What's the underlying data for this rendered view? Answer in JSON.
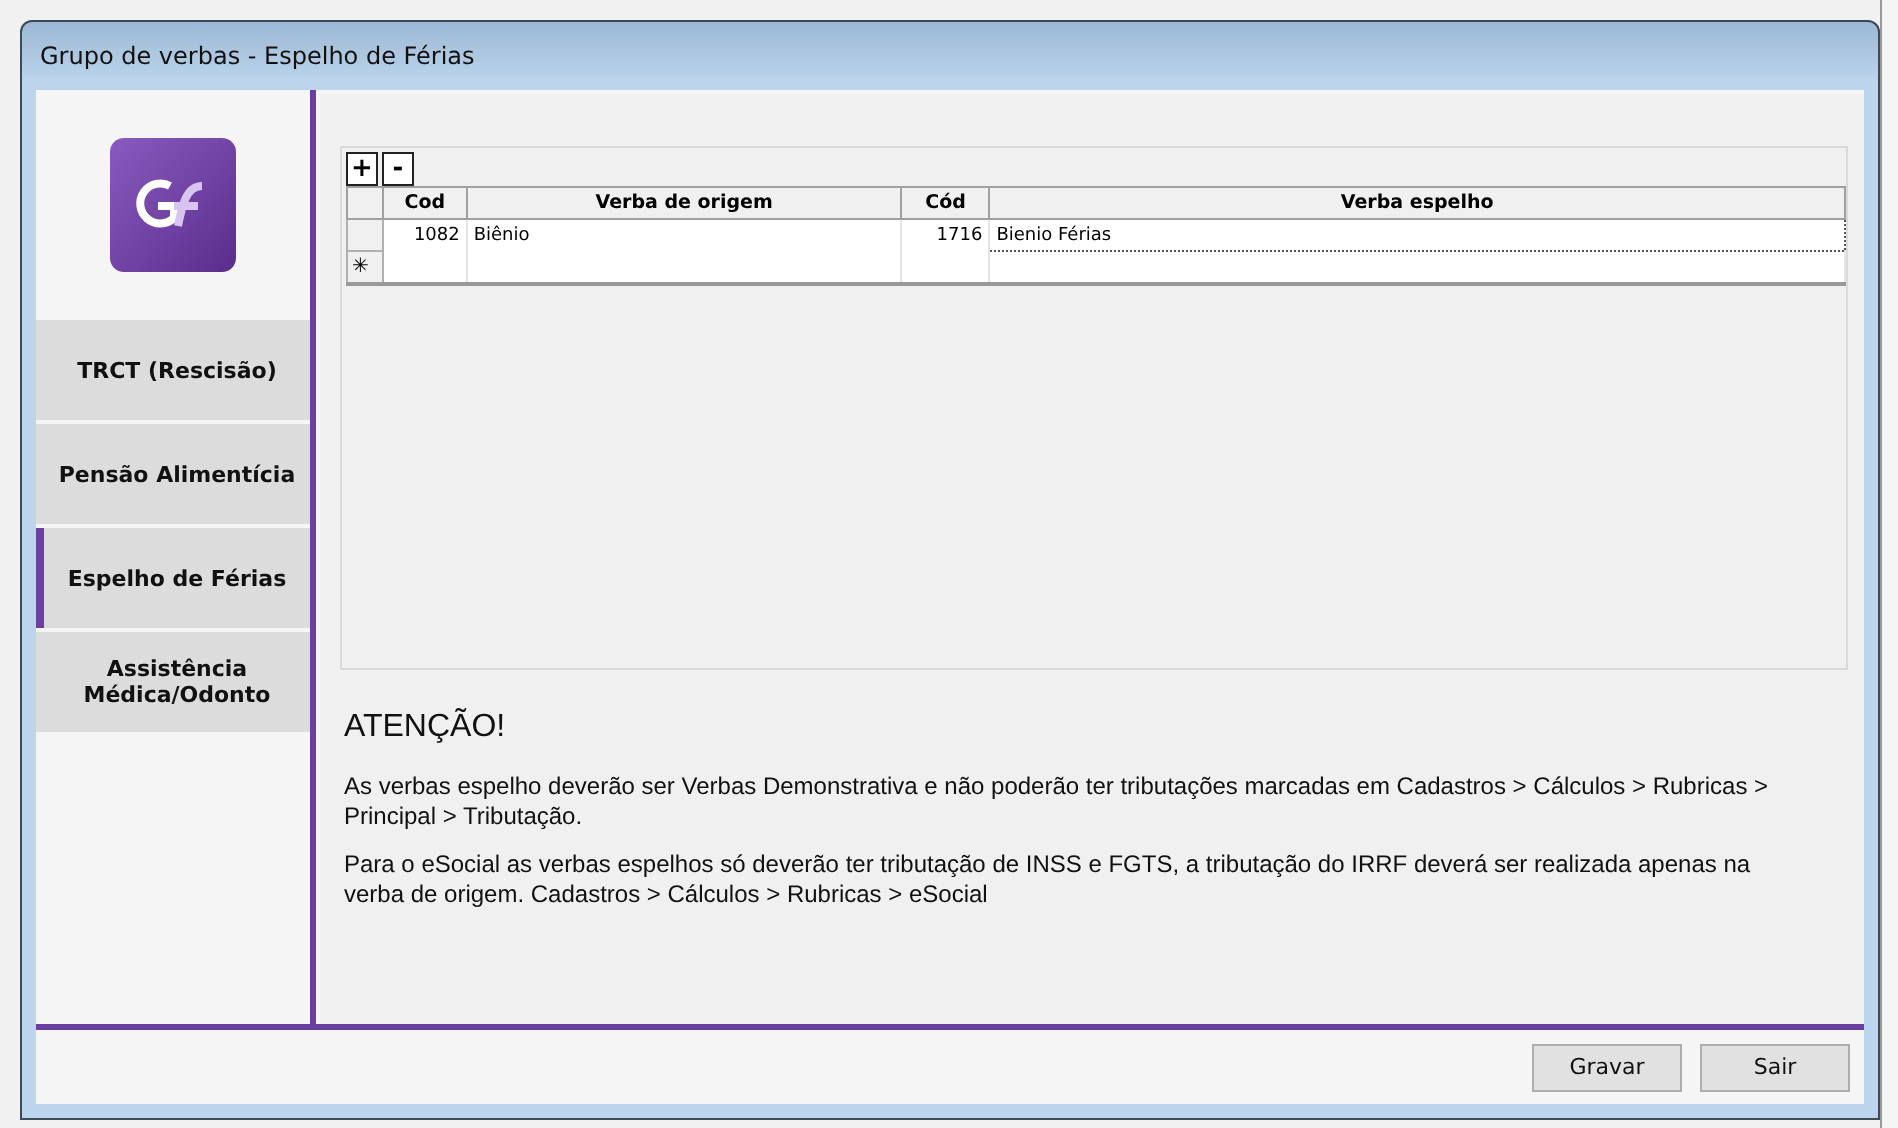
{
  "window": {
    "title": "Grupo de verbas - Espelho de Férias"
  },
  "sidebar": {
    "items": [
      {
        "label": "TRCT (Rescisão)",
        "selected": false
      },
      {
        "label": "Pensão Alimentícia",
        "selected": false
      },
      {
        "label": "Espelho de Férias",
        "selected": true
      },
      {
        "label": "Assistência Médica/Odonto",
        "selected": false
      }
    ]
  },
  "grid_buttons": [
    "+",
    "-"
  ],
  "table": {
    "columns": [
      "Cod",
      "Verba de origem",
      "Cód",
      "Verba espelho"
    ],
    "rows": [
      {
        "cells": [
          "1082",
          "Biênio",
          "1716",
          "Bienio Férias"
        ]
      }
    ],
    "new_row_marker": "✳"
  },
  "notice": {
    "title": "ATENÇÃO!",
    "paragraphs": [
      "As verbas espelho deverão ser Verbas Demonstrativa e não poderão ter tributações marcadas em Cadastros > Cálculos > Rubricas > Principal > Tributação.",
      "Para o eSocial as verbas espelhos só deverão ter tributação de INSS e FGTS, a tributação do IRRF deverá ser realizada apenas na verba de origem. Cadastros > Cálculos > Rubricas > eSocial"
    ]
  },
  "buttons": [
    "Gravar",
    "Sair"
  ]
}
